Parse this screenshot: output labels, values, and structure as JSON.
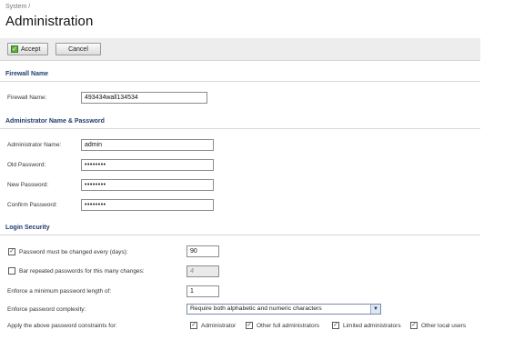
{
  "breadcrumb": "System /",
  "page_title": "Administration",
  "toolbar": {
    "accept_label": "Accept",
    "cancel_label": "Cancel"
  },
  "sections": {
    "firewall": "Firewall Name",
    "admin": "Administrator Name & Password",
    "login": "Login Security"
  },
  "firewall": {
    "name_label": "Firewall Name:",
    "name_value": "493434wall134534"
  },
  "admin": {
    "name_label": "Administrator Name:",
    "name_value": "admin",
    "old_label": "Old Password:",
    "old_value": "••••••••",
    "new_label": "New Password:",
    "new_value": "••••••••",
    "confirm_label": "Confirm Password:",
    "confirm_value": "••••••••"
  },
  "login": {
    "pw_change_label": "Password must be changed every (days):",
    "pw_change_checked": true,
    "pw_change_value": "90",
    "bar_repeat_label": "Bar repeated passwords for this many changes:",
    "bar_repeat_checked": false,
    "bar_repeat_value": "4",
    "min_length_label": "Enforce a minimum password length of:",
    "min_length_value": "1",
    "complexity_label": "Enforce password complexity:",
    "complexity_value": "Require both alphabetic and numeric characters",
    "apply_label": "Apply the above password constraints for:",
    "apply_options": [
      {
        "label": "Administrator",
        "checked": true
      },
      {
        "label": "Other full administrators",
        "checked": true
      },
      {
        "label": "Limited administrators",
        "checked": true
      },
      {
        "label": "Other local users",
        "checked": true
      }
    ]
  }
}
